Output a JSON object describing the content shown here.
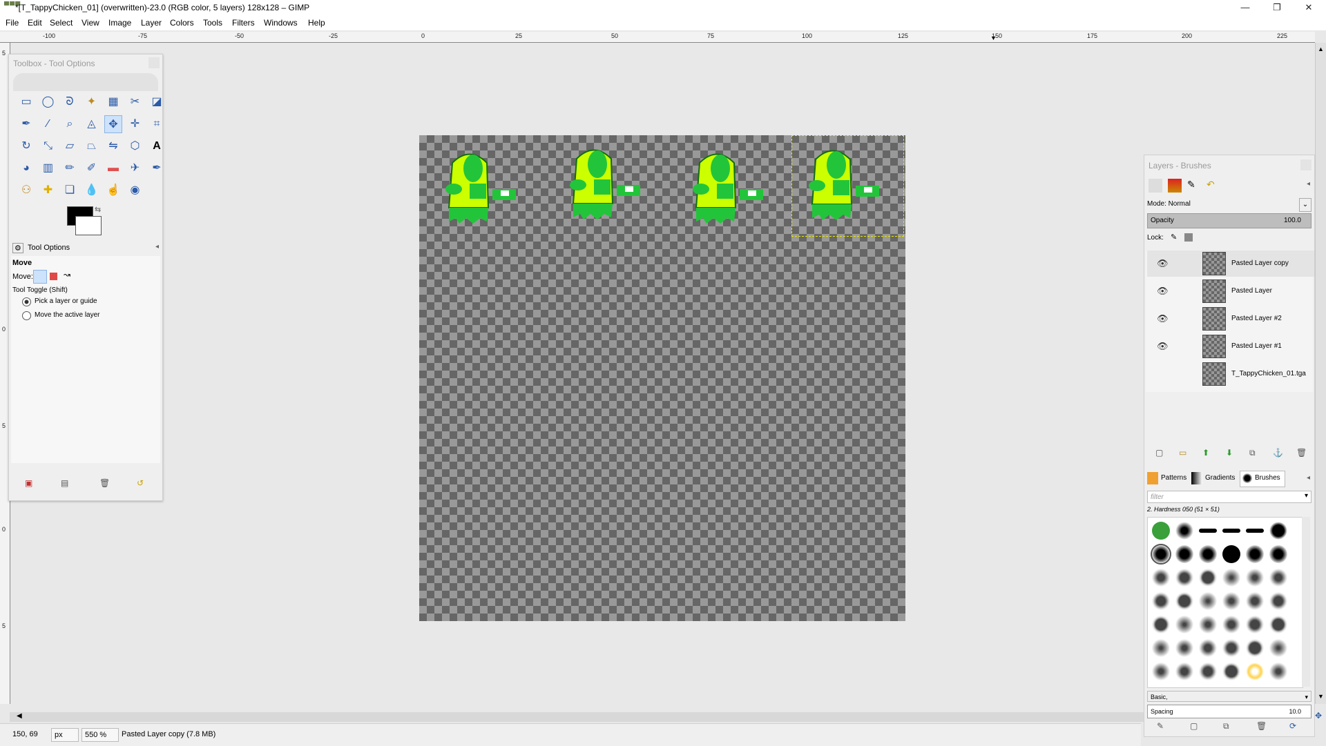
{
  "window": {
    "title": "*[T_TappyChicken_01] (overwritten)-23.0 (RGB color, 5 layers) 128x128 – GIMP",
    "minimize": "—",
    "maximize": "❐",
    "close": "✕"
  },
  "menubar": {
    "items": [
      "File",
      "Edit",
      "Select",
      "View",
      "Image",
      "Layer",
      "Colors",
      "Tools",
      "Filters",
      "Windows",
      "Help"
    ]
  },
  "ruler": {
    "top_labels": [
      "-100",
      "-75",
      "-50",
      "-25",
      "0",
      "25",
      "50",
      "75",
      "100",
      "125",
      "150",
      "175",
      "200",
      "225"
    ],
    "left_labels": [
      "5",
      "0",
      "5",
      "0",
      "5"
    ]
  },
  "toolbox": {
    "title": "Toolbox - Tool Options",
    "tools": [
      "rect-select-icon",
      "ellipse-select-icon",
      "lasso-icon",
      "fuzzy-select-icon",
      "color-select-icon",
      "scissors-icon",
      "foreground-select-icon",
      "paths-icon",
      "color-picker-icon",
      "zoom-icon",
      "measure-icon",
      "move-icon",
      "align-icon",
      "crop-icon",
      "rotate-icon",
      "scale-icon",
      "shear-icon",
      "perspective-icon",
      "flip-icon",
      "cage-icon",
      "text-icon",
      "bucket-fill-icon",
      "gradient-icon",
      "pencil-icon",
      "paintbrush-icon",
      "eraser-icon",
      "airbrush-icon",
      "ink-icon",
      "clone-icon",
      "heal-icon",
      "perspective-clone-icon",
      "blur-icon",
      "smudge-icon",
      "dodge-icon"
    ],
    "tool_options_tab": "Tool Options",
    "tool_name": "Move",
    "move_label": "Move:",
    "tool_toggle_label": "Tool Toggle  (Shift)",
    "option_pick": "Pick a layer or guide",
    "option_move_active": "Move the active layer"
  },
  "layers_dock": {
    "title": "Layers - Brushes",
    "mode_label": "Mode: Normal",
    "opacity_label": "Opacity",
    "opacity_value": "100.0",
    "lock_label": "Lock:",
    "layers": [
      {
        "name": "Pasted Layer copy",
        "visible": true
      },
      {
        "name": "Pasted Layer",
        "visible": true
      },
      {
        "name": "Pasted Layer #2",
        "visible": true
      },
      {
        "name": "Pasted Layer #1",
        "visible": true
      },
      {
        "name": "T_TappyChicken_01.tga",
        "visible": false
      }
    ],
    "tabs": [
      "Patterns",
      "Gradients",
      "Brushes"
    ],
    "filter_placeholder": "filter",
    "brush_name": "2. Hardness 050 (51 × 51)",
    "brush_tag": "Basic,",
    "spacing_label": "Spacing",
    "spacing_value": "10.0"
  },
  "statusbar": {
    "coords": "150, 69",
    "unit": "px",
    "zoom": "550 %",
    "message": "Pasted Layer copy (7.8 MB)"
  },
  "colors": {
    "chicken_yellow": "#ccff00",
    "chicken_green": "#22c53a",
    "selection": "#e8e800",
    "accent": "#2a5aa8"
  }
}
